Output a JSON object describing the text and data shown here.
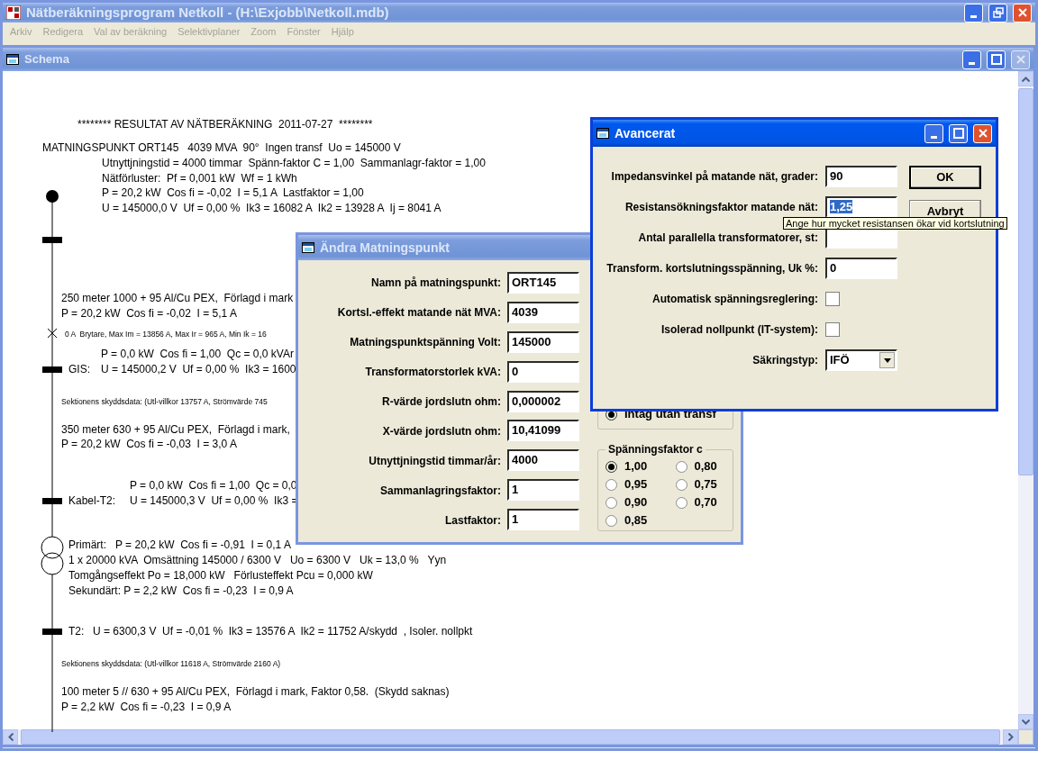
{
  "window": {
    "title": "Nätberäkningsprogram Netkoll - (H:\\Exjobb\\Netkoll.mdb)",
    "active": false,
    "controls": [
      {
        "kind": "minimize",
        "disabled": false
      },
      {
        "kind": "restore",
        "disabled": false
      },
      {
        "kind": "close",
        "disabled": false
      }
    ]
  },
  "menu": [
    {
      "label": "Arkiv",
      "disabled": true
    },
    {
      "label": "Redigera",
      "disabled": true
    },
    {
      "label": "Val av beräkning",
      "disabled": true
    },
    {
      "label": "Selektivplaner",
      "disabled": true
    },
    {
      "label": "Zoom",
      "disabled": true
    },
    {
      "label": "Fönster",
      "disabled": true
    },
    {
      "label": "Hjälp",
      "disabled": true
    }
  ],
  "schema": {
    "title": "Schema",
    "active": false,
    "controls": [
      {
        "kind": "minimize",
        "disabled": false
      },
      {
        "kind": "maximize",
        "disabled": false
      },
      {
        "kind": "close",
        "disabled": true
      }
    ],
    "lines": [
      {
        "kind": "text",
        "text": "******** RESULTAT AV NÄTBERÄKNING  2011-07-27  ********"
      },
      {
        "kind": "text",
        "text": "MATNINGSPUNKT ORT145   4039 MVA  90°  Ingen transf  Uo = 145000 V"
      },
      {
        "kind": "text",
        "text": "Utnyttjningstid = 4000 timmar  Spänn-faktor C = 1,00  Sammanlagr-faktor = 1,00"
      },
      {
        "kind": "text",
        "text": "Nätförluster:  Pf = 0,001 kW  Wf = 1 kWh"
      },
      {
        "kind": "text",
        "text": "P = 20,2 kW  Cos fi = -0,02  I = 5,1 A  Lastfaktor = 1,00"
      },
      {
        "kind": "text",
        "text": "U = 145000,0 V  Uf = 0,00 %  Ik3 = 16082 A  Ik2 = 13928 A  Ij = 8041 A"
      },
      {
        "kind": "text",
        "text": "250 meter 1000 + 95 Al/Cu PEX,  Förlagd i mark"
      },
      {
        "kind": "text",
        "text": "P = 20,2 kW  Cos fi = -0,02  I = 5,1 A"
      },
      {
        "kind": "small",
        "text": "0 A  Brytare, Max Im = 13856 A, Max Ir = 965 A, Min Ik = 16"
      },
      {
        "kind": "text",
        "text": "P = 0,0 kW  Cos fi = 1,00  Qc = 0,0 kVAr"
      },
      {
        "kind": "text",
        "text": "GIS:"
      },
      {
        "kind": "text",
        "text": "U = 145000,2 V  Uf = 0,00 %  Ik3 = 1600"
      },
      {
        "kind": "small",
        "text": "Sektionens skyddsdata: (Utl-villkor 13757 A, Strömvärde 745"
      },
      {
        "kind": "text",
        "text": "350 meter 630 + 95 Al/Cu PEX,  Förlagd i mark,"
      },
      {
        "kind": "text",
        "text": "P = 20,2 kW  Cos fi = -0,03  I = 3,0 A"
      },
      {
        "kind": "text",
        "text": "P = 0,0 kW  Cos fi = 1,00  Qc = 0,0"
      },
      {
        "kind": "text",
        "text": "Kabel-T2:"
      },
      {
        "kind": "text",
        "text": "U = 145000,3 V  Uf = 0,00 %  Ik3 ="
      },
      {
        "kind": "text",
        "text": "Primärt:   P = 20,2 kW  Cos fi = -0,91  I = 0,1 A"
      },
      {
        "kind": "text",
        "text": "1 x 20000 kVA  Omsättning 145000 / 6300 V   Uo = 6300 V   Uk = 13,0 %   Yyn"
      },
      {
        "kind": "text",
        "text": "Tomgångseffekt Po = 18,000 kW   Förlusteffekt Pcu = 0,000 kW"
      },
      {
        "kind": "text",
        "text": "Sekundärt: P = 2,2 kW  Cos fi = -0,23  I = 0,9 A"
      },
      {
        "kind": "text",
        "text": "T2:"
      },
      {
        "kind": "text",
        "text": "U = 6300,3 V  Uf = -0,01 %  Ik3 = 13576 A  Ik2 = 11752 A/skydd  , Isoler. nollpkt"
      },
      {
        "kind": "small",
        "text": "Sektionens skyddsdata: (Utl-villkor 11618 A, Strömvärde 2160 A)"
      },
      {
        "kind": "text",
        "text": "100 meter 5 // 630 + 95 Al/Cu PEX,  Förlagd i mark, Faktor 0,58.  (Skydd saknas)"
      },
      {
        "kind": "text",
        "text": "P = 2,2 kW  Cos fi = -0,23  I = 0,9 A"
      }
    ]
  },
  "edit_dialog": {
    "title": "Ändra Matningspunkt",
    "active": false,
    "fields": [
      {
        "label": "Namn på matningspunkt:",
        "value": "ORT145"
      },
      {
        "label": "Kortsl.-effekt matande nät MVA:",
        "value": "4039"
      },
      {
        "label": "Matningspunktspänning Volt:",
        "value": "145000"
      },
      {
        "label": "Transformatorstorlek kVA:",
        "value": "0"
      },
      {
        "label": "R-värde jordslutn ohm:",
        "value": "0,000002"
      },
      {
        "label": "X-värde jordslutn ohm:",
        "value": "10,41099"
      },
      {
        "label": "Utnyttjningstid timmar/år:",
        "value": "4000"
      },
      {
        "label": "Sammanlagringsfaktor:",
        "value": "1"
      },
      {
        "label": "Lastfaktor:",
        "value": "1"
      }
    ],
    "intake_option": {
      "label": "Intag utan transf",
      "selected": true
    },
    "voltage_factor": {
      "title": "Spänningsfaktor c",
      "options": [
        {
          "label": "1,00",
          "selected": true
        },
        {
          "label": "0,95",
          "selected": false
        },
        {
          "label": "0,90",
          "selected": false
        },
        {
          "label": "0,85",
          "selected": false
        },
        {
          "label": "0,80",
          "selected": false
        },
        {
          "label": "0,75",
          "selected": false
        },
        {
          "label": "0,70",
          "selected": false
        }
      ]
    }
  },
  "advanced_dialog": {
    "title": "Avancerat",
    "active": true,
    "controls": [
      {
        "kind": "minimize",
        "disabled": false
      },
      {
        "kind": "maximize",
        "disabled": false
      },
      {
        "kind": "close",
        "disabled": false
      }
    ],
    "fields": [
      {
        "kind": "text",
        "label": "Impedansvinkel på matande nät, grader:",
        "value": "90",
        "text_selected": false
      },
      {
        "kind": "text",
        "label": "Resistansökningsfaktor matande nät:",
        "value": "1,25",
        "text_selected": true
      },
      {
        "kind": "text",
        "label": "Antal parallella transformatorer, st:"
      },
      {
        "kind": "text",
        "label": "Transform. kortslutningsspänning, Uk %:",
        "value": "0",
        "text_selected": false
      },
      {
        "kind": "checkbox",
        "label": "Automatisk spänningsreglering:",
        "checked": false
      },
      {
        "kind": "checkbox",
        "label": "Isolerad nollpunkt (IT-system):",
        "checked": false
      },
      {
        "kind": "select",
        "label": "Säkringstyp:",
        "value": "IFÖ"
      }
    ],
    "buttons": [
      {
        "label": "OK",
        "default": true
      },
      {
        "label": "Avbryt",
        "default": false
      }
    ],
    "tooltip": "Ange hur mycket resistansen ökar vid kortslutning"
  }
}
